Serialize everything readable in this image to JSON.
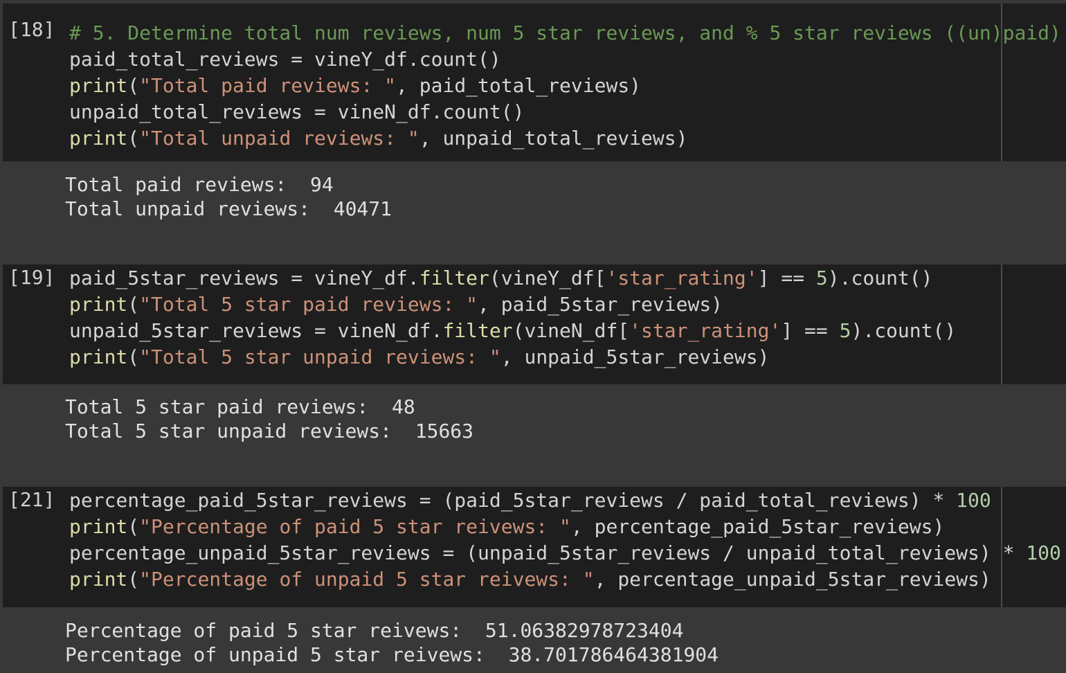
{
  "cells": [
    {
      "prompt": "[18]",
      "code": [
        [
          [
            "comment",
            "# 5. Determine total num reviews, num 5 star reviews, and % 5 star reviews ((un)paid)"
          ]
        ],
        [
          [
            "plain",
            "paid_total_reviews = vineY_df.count()"
          ]
        ],
        [
          [
            "func",
            "print"
          ],
          [
            "plain",
            "("
          ],
          [
            "string",
            "\"Total paid reviews: \""
          ],
          [
            "plain",
            ", paid_total_reviews)"
          ]
        ],
        [
          [
            "plain",
            "unpaid_total_reviews = vineN_df.count()"
          ]
        ],
        [
          [
            "func",
            "print"
          ],
          [
            "plain",
            "("
          ],
          [
            "string",
            "\"Total unpaid reviews: \""
          ],
          [
            "plain",
            ", unpaid_total_reviews)"
          ]
        ]
      ],
      "output": [
        "Total paid reviews:  94",
        "Total unpaid reviews:  40471"
      ]
    },
    {
      "prompt": "[19]",
      "code": [
        [
          [
            "plain",
            "paid_5star_reviews = vineY_df."
          ],
          [
            "func",
            "filter"
          ],
          [
            "plain",
            "(vineY_df["
          ],
          [
            "string",
            "'star_rating'"
          ],
          [
            "plain",
            "] == "
          ],
          [
            "num",
            "5"
          ],
          [
            "plain",
            ").count()"
          ]
        ],
        [
          [
            "func",
            "print"
          ],
          [
            "plain",
            "("
          ],
          [
            "string",
            "\"Total 5 star paid reviews: \""
          ],
          [
            "plain",
            ", paid_5star_reviews)"
          ]
        ],
        [
          [
            "plain",
            "unpaid_5star_reviews = vineN_df."
          ],
          [
            "func",
            "filter"
          ],
          [
            "plain",
            "(vineN_df["
          ],
          [
            "string",
            "'star_rating'"
          ],
          [
            "plain",
            "] == "
          ],
          [
            "num",
            "5"
          ],
          [
            "plain",
            ").count()"
          ]
        ],
        [
          [
            "func",
            "print"
          ],
          [
            "plain",
            "("
          ],
          [
            "string",
            "\"Total 5 star unpaid reviews: \""
          ],
          [
            "plain",
            ", unpaid_5star_reviews)"
          ]
        ]
      ],
      "output": [
        "Total 5 star paid reviews:  48",
        "Total 5 star unpaid reviews:  15663"
      ]
    },
    {
      "prompt": "[21]",
      "code": [
        [
          [
            "plain",
            "percentage_paid_5star_reviews = (paid_5star_reviews / paid_total_reviews) * "
          ],
          [
            "num",
            "100"
          ]
        ],
        [
          [
            "func",
            "print"
          ],
          [
            "plain",
            "("
          ],
          [
            "string",
            "\"Percentage of paid 5 star reivews: \""
          ],
          [
            "plain",
            ", percentage_paid_5star_reviews)"
          ]
        ],
        [
          [
            "plain",
            "percentage_unpaid_5star_reviews = (unpaid_5star_reviews / unpaid_total_reviews) * "
          ],
          [
            "num",
            "100"
          ]
        ],
        [
          [
            "func",
            "print"
          ],
          [
            "plain",
            "("
          ],
          [
            "string",
            "\"Percentage of unpaid 5 star reivews: \""
          ],
          [
            "plain",
            ", percentage_unpaid_5star_reviews)"
          ]
        ]
      ],
      "output": [
        "Percentage of paid 5 star reivews:  51.06382978723404",
        "Percentage of unpaid 5 star reivews:  38.701786464381904"
      ]
    }
  ]
}
